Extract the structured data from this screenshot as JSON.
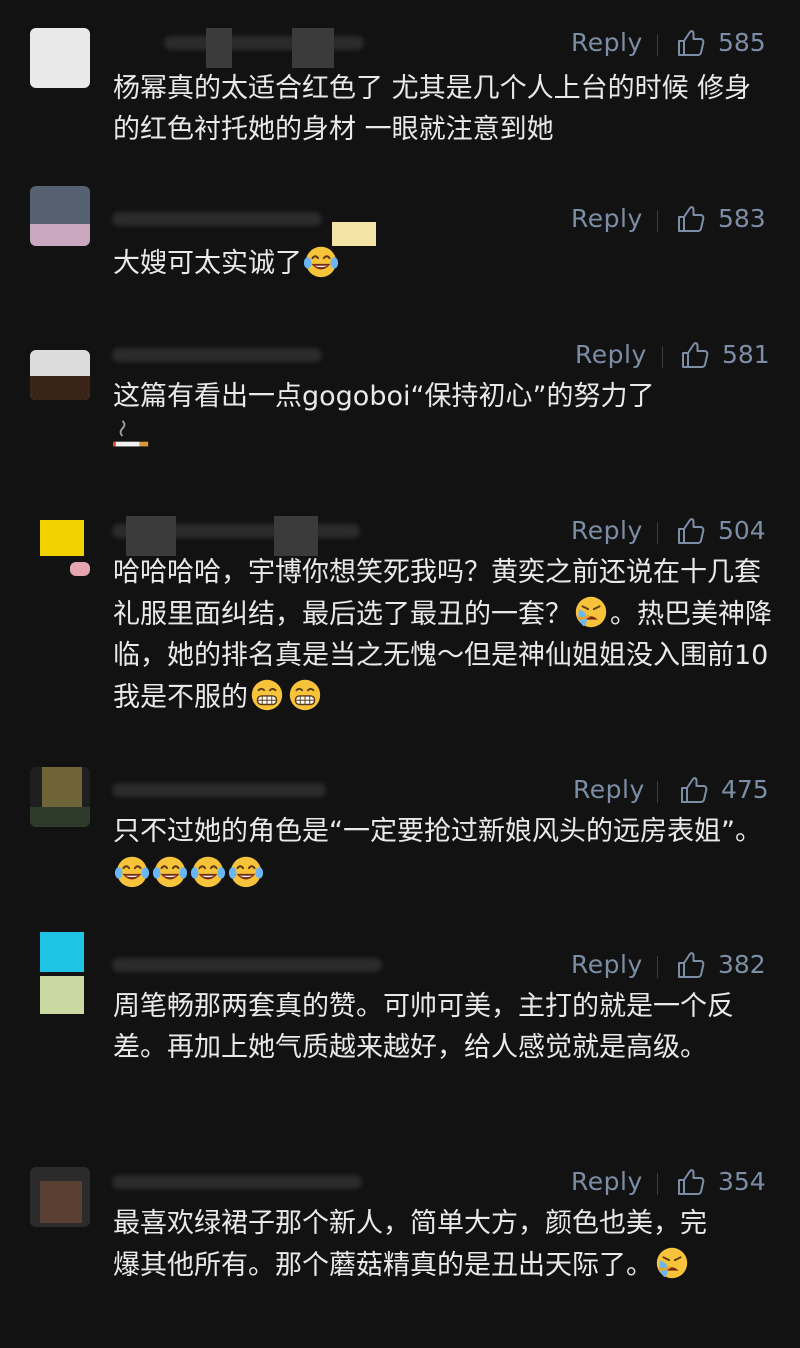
{
  "colors": {
    "background": "#121212",
    "action_text": "#7b8ea6",
    "comment_text": "#e9e9e9"
  },
  "comments": [
    {
      "reply_label": "Reply",
      "likes": "585",
      "text": "杨幂真的太适合红色了  尤其是几个人上台的时候 修身的红色衬托她的身材  一眼就注意到她"
    },
    {
      "reply_label": "Reply",
      "likes": "583",
      "text": "大嫂可太实诚了",
      "emojis": [
        "laughing-tears-emoji"
      ]
    },
    {
      "reply_label": "Reply",
      "likes": "581",
      "text": "这篇有看出一点gogoboi“保持初心”的努力了",
      "emojis": [
        "cigarette-emoji"
      ]
    },
    {
      "reply_label": "Reply",
      "likes": "504",
      "text_a": "哈哈哈哈，宇博你想笑死我吗？黄奕之前还说在十几套礼服里面纠结，最后选了最丑的一套？",
      "text_b": "。热巴美神降临，她的排名真是当之无愧～但是神仙姐姐没入围前10我是不服的",
      "emojis": [
        "crying-face-emoji",
        "grinning-face-emoji",
        "grinning-face-emoji"
      ]
    },
    {
      "reply_label": "Reply",
      "likes": "475",
      "text": "只不过她的角色是“一定要抢过新娘风头的远房表姐”。",
      "emojis": [
        "laughing-tears-emoji",
        "laughing-tears-emoji",
        "laughing-tears-emoji",
        "laughing-tears-emoji"
      ]
    },
    {
      "reply_label": "Reply",
      "likes": "382",
      "text": "周笔畅那两套真的赞。可帅可美，主打的就是一个反差。再加上她气质越来越好，给人感觉就是高级。"
    },
    {
      "reply_label": "Reply",
      "likes": "354",
      "text": "最喜欢绿裙子那个新人，简单大方，颜色也美，完爆其他所有。那个蘑菇精真的是丑出天际了。",
      "emojis": [
        "crying-face-emoji"
      ]
    }
  ]
}
